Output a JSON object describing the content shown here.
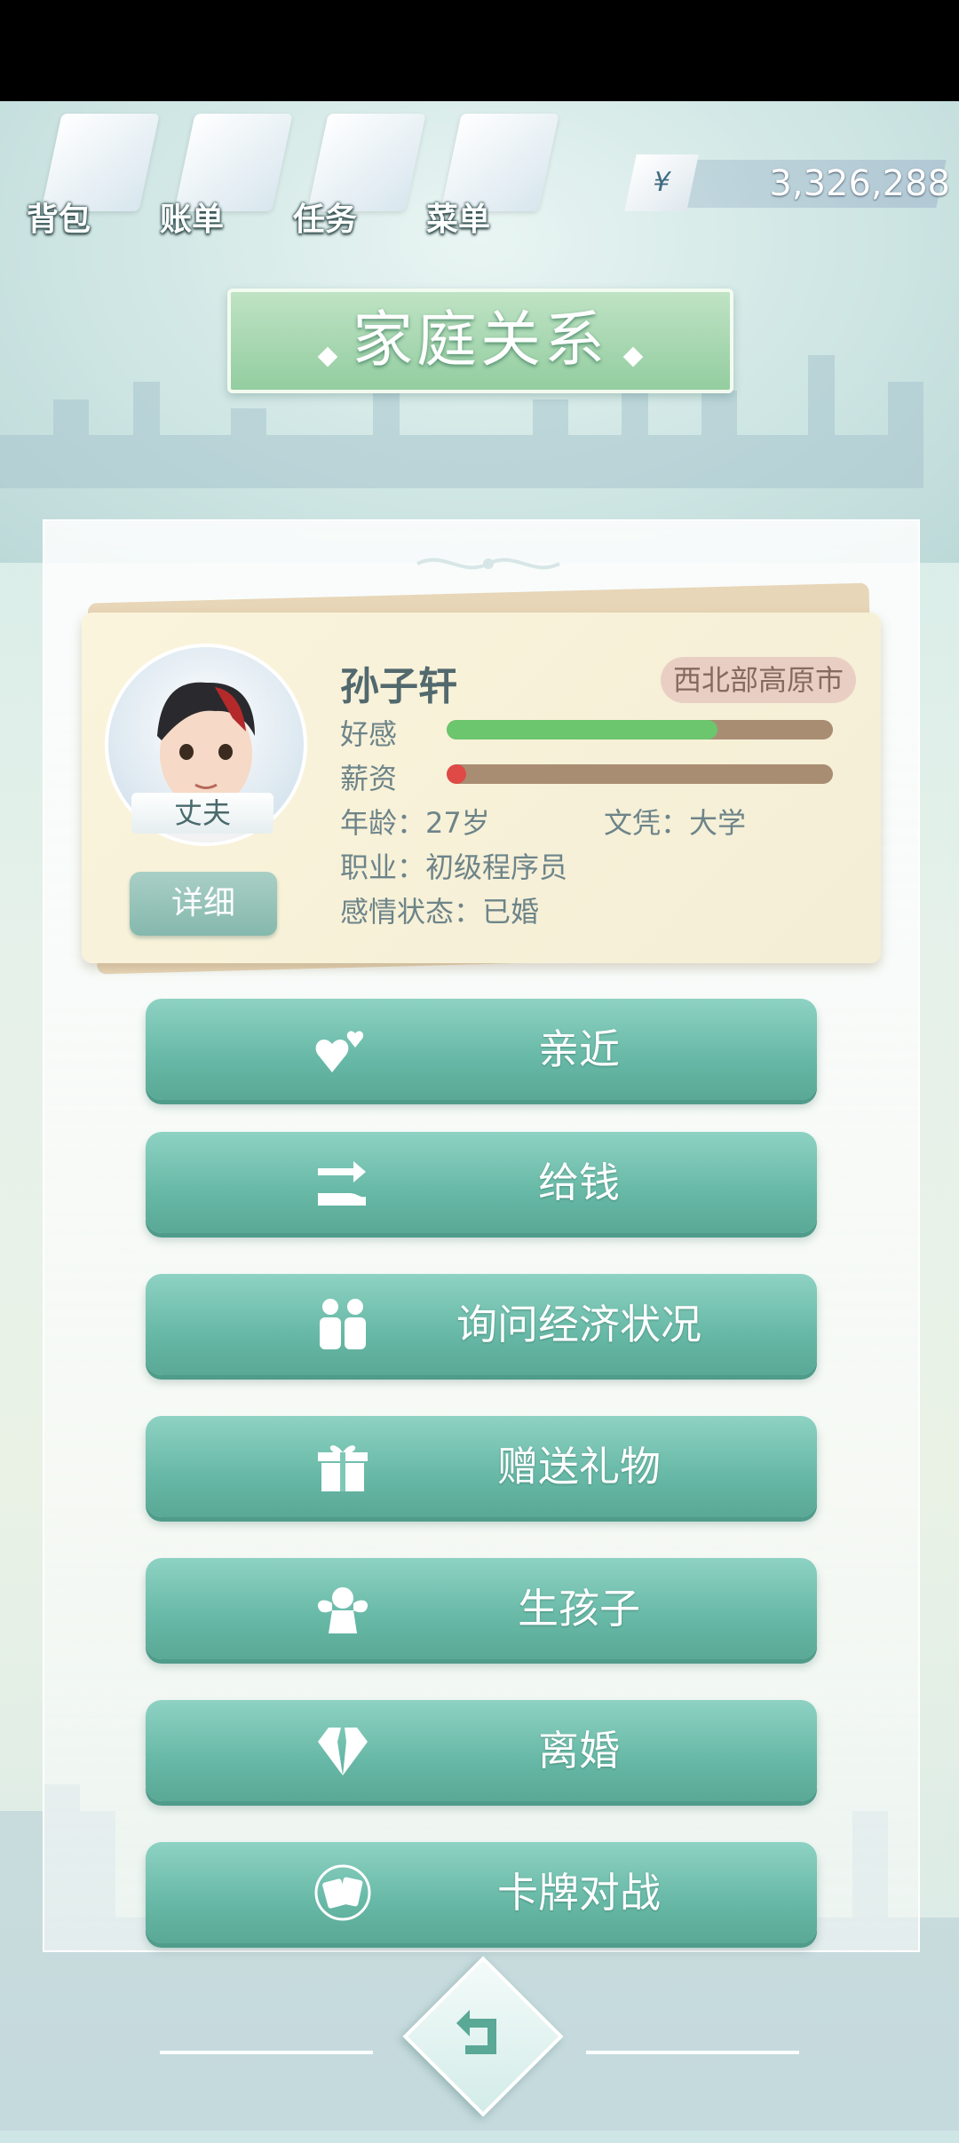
{
  "header": {
    "menu": [
      {
        "label": "背包",
        "icon": "bag-icon"
      },
      {
        "label": "账单",
        "icon": "bill-icon"
      },
      {
        "label": "任务",
        "icon": "task-icon"
      },
      {
        "label": "菜单",
        "icon": "menu-icon"
      }
    ],
    "currency_symbol": "¥",
    "money": "3,326,288"
  },
  "title": "家庭关系",
  "profile": {
    "name": "孙子轩",
    "role": "丈夫",
    "city": "西北部高原市",
    "affection_label": "好感",
    "affection_level": 0.7,
    "salary_label": "薪资",
    "salary_level": 0.05,
    "age": "年龄：27岁",
    "education": "文凭：大学",
    "job": "职业：初级程序员",
    "relationship": "感情状态：已婚",
    "detail_button": "详细"
  },
  "actions": [
    {
      "label": "亲近",
      "icon": "hearts-icon"
    },
    {
      "label": "给钱",
      "icon": "give-money-icon"
    },
    {
      "label": "询问经济状况",
      "icon": "people-icon"
    },
    {
      "label": "赠送礼物",
      "icon": "gift-icon"
    },
    {
      "label": "生孩子",
      "icon": "angel-icon"
    },
    {
      "label": "离婚",
      "icon": "broken-diamond-icon"
    },
    {
      "label": "卡牌对战",
      "icon": "cards-icon"
    }
  ],
  "colors": {
    "affection": "#6cc66d",
    "salary": "#e04a46",
    "button": "#6cbaa8"
  }
}
